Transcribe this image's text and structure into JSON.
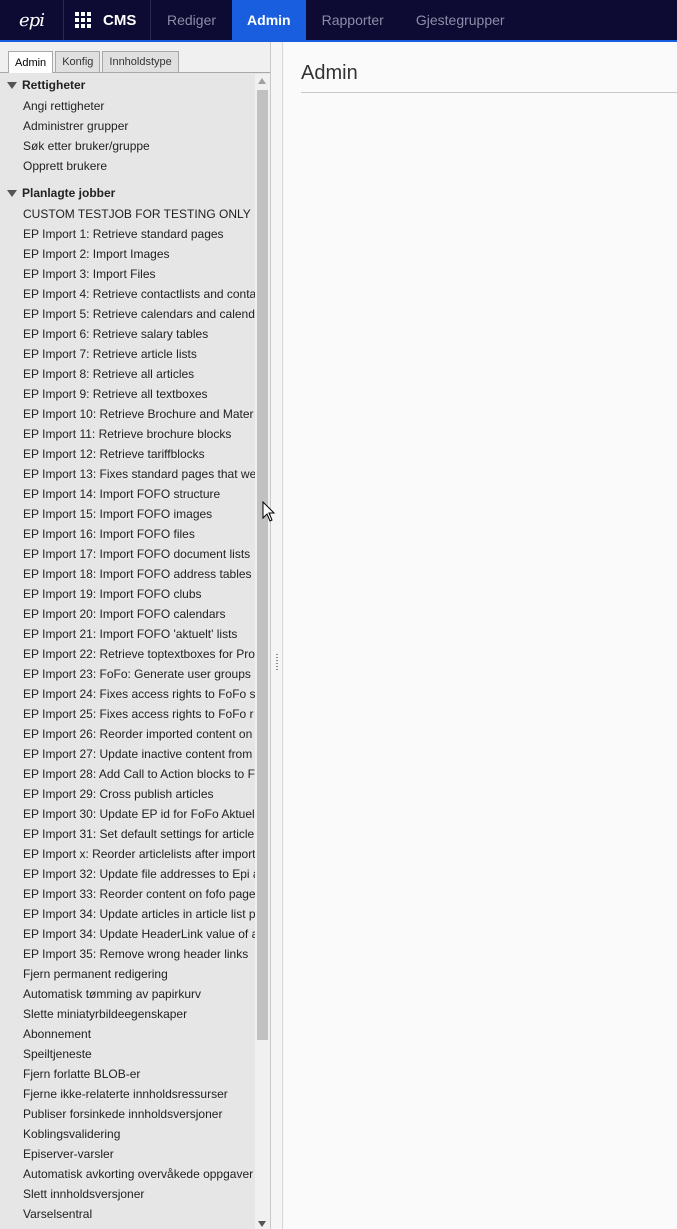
{
  "topbar": {
    "logo_text": "epi",
    "app_name": "CMS",
    "tabs": [
      "Rediger",
      "Admin",
      "Rapporter",
      "Gjestegrupper"
    ],
    "active_tab": "Admin"
  },
  "subtabs": [
    "Admin",
    "Konfig",
    "Innholdstype"
  ],
  "sections": [
    {
      "title": "Rettigheter",
      "items": [
        "Angi rettigheter",
        "Administrer grupper",
        "Søk etter bruker/gruppe",
        "Opprett brukere"
      ]
    },
    {
      "title": "Planlagte jobber",
      "items": [
        "CUSTOM TESTJOB FOR TESTING ONLY",
        "EP Import 1: Retrieve standard pages",
        "EP Import 2: Import Images",
        "EP Import 3: Import Files",
        "EP Import 4: Retrieve contactlists and conta",
        "EP Import 5: Retrieve calendars and calend",
        "EP Import 6: Retrieve salary tables",
        "EP Import 7: Retrieve article lists",
        "EP Import 8: Retrieve all articles",
        "EP Import 9: Retrieve all textboxes",
        "EP Import 10: Retrieve Brochure and Mater",
        "EP Import 11: Retrieve brochure blocks",
        "EP Import 12: Retrieve tariffblocks",
        "EP Import 13: Fixes standard pages that we",
        "EP Import 14: Import FOFO structure",
        "EP Import 15: Import FOFO images",
        "EP Import 16: Import FOFO files",
        "EP Import 17: Import FOFO document lists",
        "EP Import 18: Import FOFO address tables",
        "EP Import 19: Import FOFO clubs",
        "EP Import 20: Import FOFO calendars",
        "EP Import 21: Import FOFO 'aktuelt' lists",
        "EP Import 22: Retrieve toptextboxes for Pro",
        "EP Import 23: FoFo: Generate user groups",
        "EP Import 24: Fixes access rights to FoFo s",
        "EP Import 25: Fixes access rights to FoFo r",
        "EP Import 26: Reorder imported content on",
        "EP Import 27: Update inactive content from",
        "EP Import 28: Add Call to Action blocks to F",
        "EP Import 29: Cross publish articles",
        "EP Import 30: Update EP id for FoFo Aktuel",
        "EP Import 31: Set default settings for article",
        "EP Import x: Reorder articlelists after import",
        "EP Import 32: Update file addresses to Epi a",
        "EP Import 33: Reorder content on fofo page",
        "EP Import 34: Update articles in article list p",
        "EP Import 34: Update HeaderLink value of a",
        "EP Import 35: Remove wrong header links",
        "Fjern permanent redigering",
        "Automatisk tømming av papirkurv",
        "Slette miniatyrbildeegenskaper",
        "Abonnement",
        "Speiltjeneste",
        "Fjern forlatte BLOB-er",
        "Fjerne ikke-relaterte innholdsressurser",
        "Publiser forsinkede innholdsversjoner",
        "Koblingsvalidering",
        "Episerver-varsler",
        "Automatisk avkorting overvåkede oppgaver",
        "Slett innholdsversjoner",
        "Varselsentral"
      ]
    }
  ],
  "main": {
    "title": "Admin"
  }
}
